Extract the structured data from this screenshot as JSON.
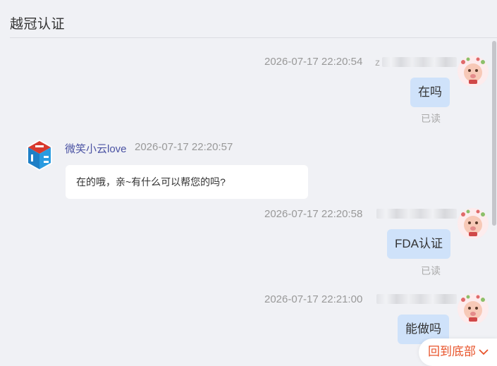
{
  "header": {
    "title": "越冠认证"
  },
  "messages": [
    {
      "side": "me",
      "time": "2026-07-17 22:20:54",
      "name_visible": "z",
      "text": "在吗",
      "status": "已读"
    },
    {
      "side": "other",
      "sender": "微笑小云love",
      "time": "2026-07-17 22:20:57",
      "text": "在的哦，亲~有什么可以帮您的吗?"
    },
    {
      "side": "me",
      "time": "2026-07-17 22:20:58",
      "text": "FDA认证",
      "status": "已读"
    },
    {
      "side": "me",
      "time": "2026-07-17 22:21:00",
      "text": "能做吗"
    }
  ],
  "back_to_bottom": {
    "label": "回到底部",
    "icon": "chevron-down-icon"
  },
  "colors": {
    "accent": "#e8532a",
    "my_bubble": "#cfe2fa",
    "sender_name": "#4a52a3",
    "background": "#f0f1f5"
  }
}
